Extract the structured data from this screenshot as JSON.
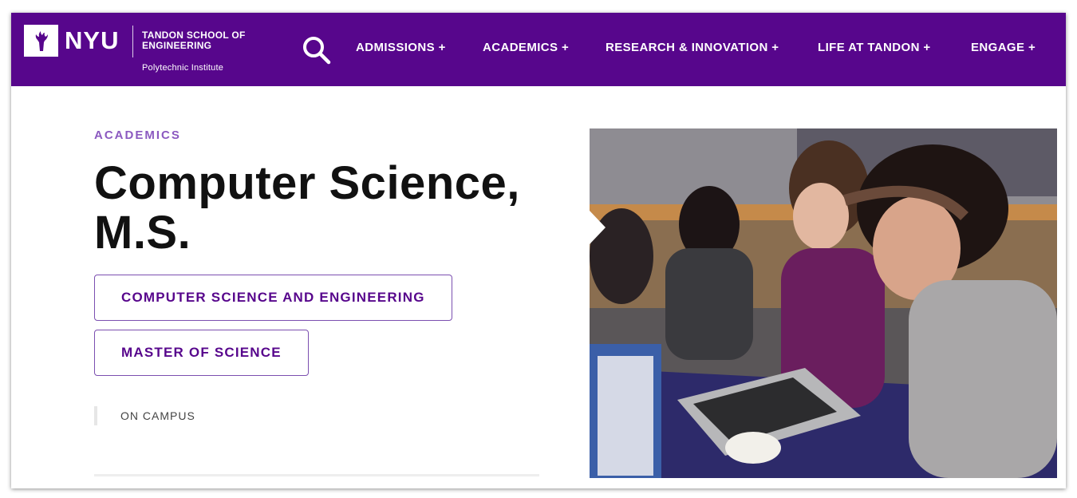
{
  "header": {
    "brand": "NYU",
    "school_name": "TANDON SCHOOL OF ENGINEERING",
    "subtitle": "Polytechnic Institute",
    "nav": [
      {
        "label": "ADMISSIONS +"
      },
      {
        "label": "ACADEMICS +"
      },
      {
        "label": "RESEARCH & INNOVATION +"
      },
      {
        "label": "LIFE AT TANDON +"
      },
      {
        "label": "ENGAGE +"
      }
    ],
    "icons": {
      "logo": "nyu-torch-icon",
      "search": "search-icon"
    }
  },
  "main": {
    "eyebrow": "ACADEMICS",
    "title": "Computer Science, M.S.",
    "tags": [
      {
        "label": "COMPUTER SCIENCE AND ENGINEERING"
      },
      {
        "label": "MASTER OF SCIENCE"
      }
    ],
    "format": "ON CAMPUS"
  },
  "colors": {
    "brand_purple": "#57068c",
    "accent_purple": "#8b59c0",
    "title": "#111111"
  }
}
